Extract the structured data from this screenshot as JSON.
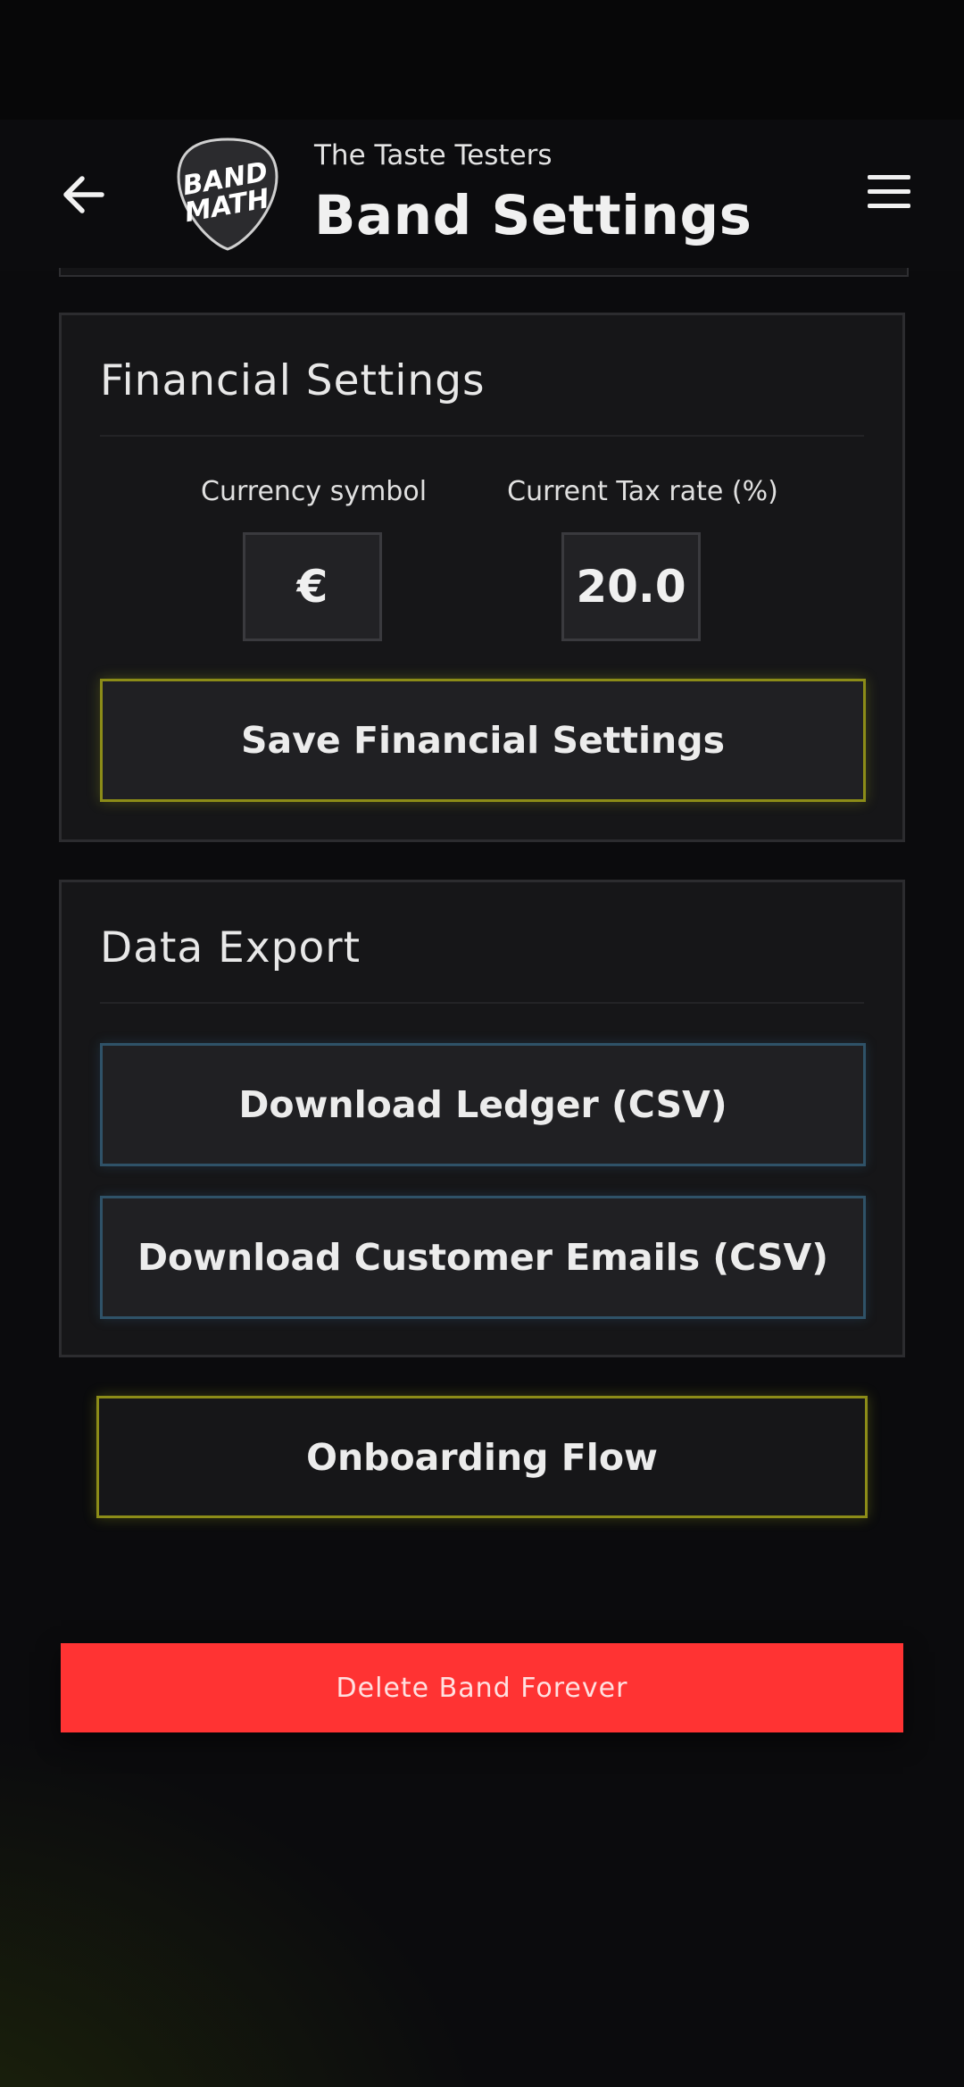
{
  "header": {
    "subtitle": "The Taste Testers",
    "title": "Band Settings",
    "logo_text_line1": "BAND",
    "logo_text_line2": "MATH",
    "back_icon": "arrow-left-icon",
    "menu_icon": "hamburger-menu-icon"
  },
  "financial": {
    "title": "Financial Settings",
    "currency_label": "Currency symbol",
    "currency_value": "€",
    "tax_label": "Current Tax rate (%)",
    "tax_value": "20.0",
    "save_label": "Save Financial Settings"
  },
  "export": {
    "title": "Data Export",
    "ledger_label": "Download Ledger (CSV)",
    "emails_label": "Download Customer Emails (CSV)"
  },
  "onboarding_label": "Onboarding Flow",
  "delete_label": "Delete Band Forever",
  "colors": {
    "background": "#0b0b0d",
    "card": "#161618",
    "accent_yellow": "#8c8c18",
    "accent_blue": "#2f5268",
    "danger": "#ff3333"
  }
}
